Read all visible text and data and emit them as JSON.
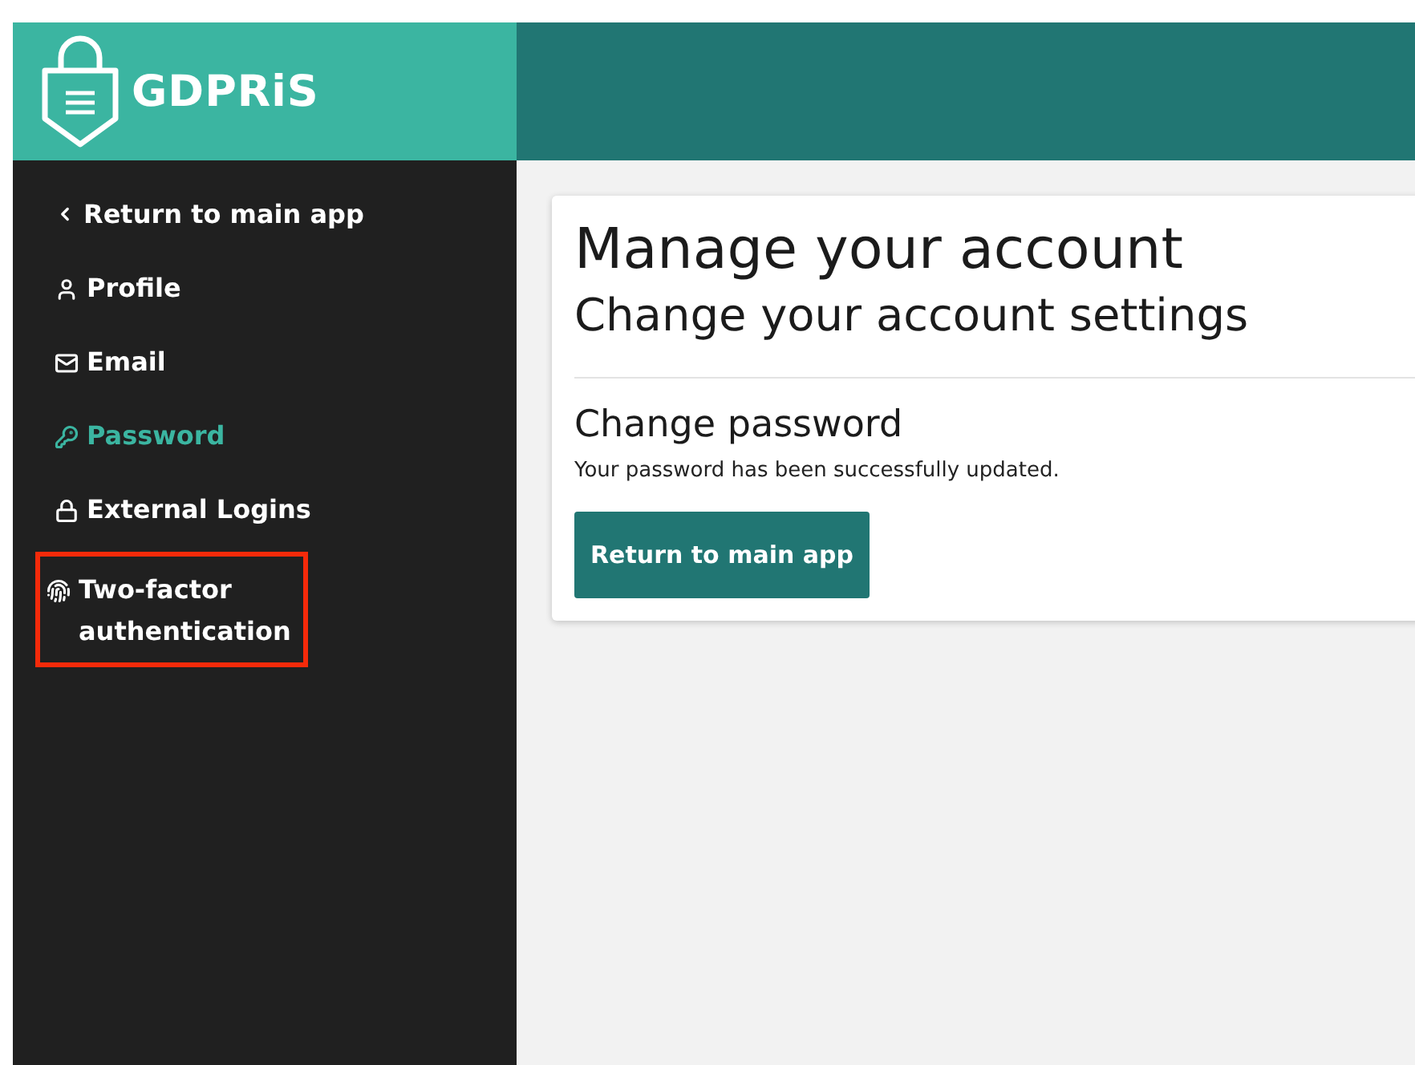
{
  "brand": {
    "name": "GDPRiS"
  },
  "sidebar": {
    "items": [
      {
        "kind": "back",
        "label": "Return to main app",
        "selected": false,
        "highlighted": false
      },
      {
        "kind": "profile",
        "label": "Profile",
        "selected": false,
        "highlighted": false
      },
      {
        "kind": "email",
        "label": "Email",
        "selected": false,
        "highlighted": false
      },
      {
        "kind": "password",
        "label": "Password",
        "selected": true,
        "highlighted": false
      },
      {
        "kind": "external",
        "label": "External Logins",
        "selected": false,
        "highlighted": false
      },
      {
        "kind": "twofactor",
        "label": "Two-factor authentication",
        "selected": false,
        "highlighted": true
      }
    ]
  },
  "card": {
    "title": "Manage your account",
    "subtitle": "Change your account settings",
    "section_title": "Change password",
    "message": "Your password has been successfully updated.",
    "button": "Return to main app"
  }
}
